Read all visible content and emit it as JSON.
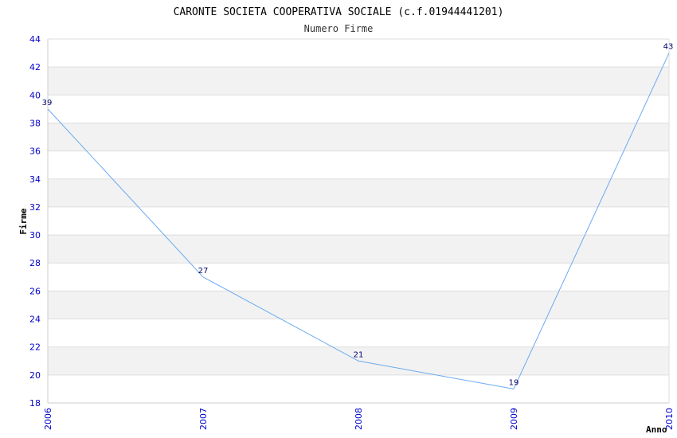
{
  "chart_data": {
    "type": "line",
    "title": "CARONTE SOCIETA COOPERATIVA SOCIALE (c.f.01944441201)",
    "subtitle": "Numero Firme",
    "xlabel": "Anno",
    "ylabel": "Firme",
    "x": [
      "2006",
      "2007",
      "2008",
      "2009",
      "2010"
    ],
    "values": [
      39,
      27,
      21,
      19,
      43
    ],
    "ylim": [
      18,
      44
    ],
    "yticks": [
      18,
      20,
      22,
      24,
      26,
      28,
      30,
      32,
      34,
      36,
      38,
      40,
      42,
      44
    ],
    "grid": true,
    "colors": {
      "line": "#6aaaf0",
      "band": "#f2f2f2",
      "tick": "#0000cc",
      "data_label": "#000066"
    }
  }
}
